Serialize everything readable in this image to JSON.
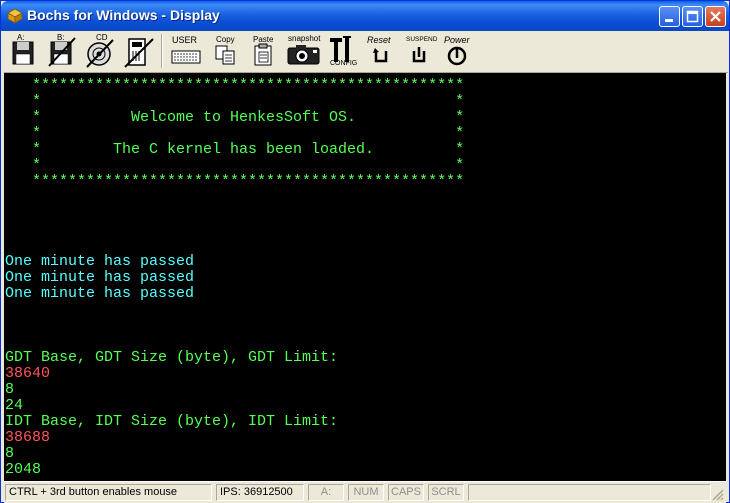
{
  "window": {
    "title": "Bochs for Windows - Display"
  },
  "toolbar": {
    "floppy_a_label": "A:",
    "floppy_b_label": "B:",
    "cdrom_label": "CD",
    "user_label": "USER",
    "copy_label": "Copy",
    "paste_label": "Paste",
    "snapshot_label": "snapshot",
    "config_label": "CONFIG",
    "reset_label": "Reset",
    "suspend_label": "SUSPEND",
    "power_label": "Power"
  },
  "screen": {
    "banner_top": "************************************************",
    "banner_side_1": "*                                              *",
    "welcome": "*          Welcome to HenkesSoft OS.           *",
    "banner_side_2": "*                                              *",
    "kernel": "*        The C kernel has been loaded.         *",
    "banner_side_3": "*                                              *",
    "banner_bottom": "************************************************",
    "minute_1": "One minute has passed",
    "minute_2": "One minute has passed",
    "minute_3": "One minute has passed",
    "gdt_header": "GDT Base, GDT Size (byte), GDT Limit:",
    "gdt_base": "38640",
    "gdt_size": "8",
    "gdt_limit": "24",
    "idt_header": "IDT Base, IDT Size (byte), IDT Limit:",
    "idt_base": "38688",
    "idt_size": "8",
    "idt_limit": "2048"
  },
  "statusbar": {
    "hint": "CTRL + 3rd button enables mouse",
    "ips": "IPS:  36912500",
    "drive": "A:",
    "num": "NUM",
    "caps": "CAPS",
    "scrl": "SCRL"
  },
  "colors": {
    "green": "#55ff55",
    "cyan": "#55ffff",
    "red": "#ff5555"
  }
}
